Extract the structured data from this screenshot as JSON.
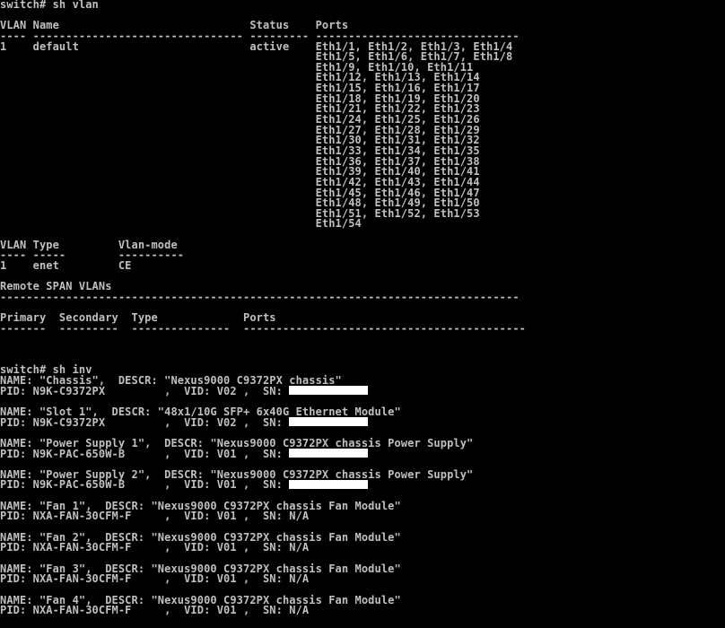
{
  "terminal": {
    "text_color": "#c0c0c0",
    "background": "#000000",
    "lines": [
      "switch# sh vlan",
      "",
      "VLAN Name                             Status    Ports",
      "---- -------------------------------- --------- -------------------------------",
      "1    default                          active    Eth1/1, Eth1/2, Eth1/3, Eth1/4",
      "                                                Eth1/5, Eth1/6, Eth1/7, Eth1/8",
      "                                                Eth1/9, Eth1/10, Eth1/11",
      "                                                Eth1/12, Eth1/13, Eth1/14",
      "                                                Eth1/15, Eth1/16, Eth1/17",
      "                                                Eth1/18, Eth1/19, Eth1/20",
      "                                                Eth1/21, Eth1/22, Eth1/23",
      "                                                Eth1/24, Eth1/25, Eth1/26",
      "                                                Eth1/27, Eth1/28, Eth1/29",
      "                                                Eth1/30, Eth1/31, Eth1/32",
      "                                                Eth1/33, Eth1/34, Eth1/35",
      "                                                Eth1/36, Eth1/37, Eth1/38",
      "                                                Eth1/39, Eth1/40, Eth1/41",
      "                                                Eth1/42, Eth1/43, Eth1/44",
      "                                                Eth1/45, Eth1/46, Eth1/47",
      "                                                Eth1/48, Eth1/49, Eth1/50",
      "                                                Eth1/51, Eth1/52, Eth1/53",
      "                                                Eth1/54",
      "",
      "VLAN Type         Vlan-mode",
      "---- -----        ----------",
      "1    enet         CE",
      "",
      "Remote SPAN VLANs",
      "-------------------------------------------------------------------------------",
      "",
      "Primary  Secondary  Type             Ports",
      "-------  ---------  ---------------  -------------------------------------------",
      "",
      "",
      "",
      "switch# sh inv",
      "NAME: \"Chassis\",  DESCR: \"Nexus9000 C9372PX chassis\"",
      "PID: N9K-C9372PX         ,  VID: V02 ,  SN: ",
      "",
      "NAME: \"Slot 1\",  DESCR: \"48x1/10G SFP+ 6x40G Ethernet Module\"",
      "PID: N9K-C9372PX         ,  VID: V02 ,  SN: ",
      "",
      "NAME: \"Power Supply 1\",  DESCR: \"Nexus9000 C9372PX chassis Power Supply\"",
      "PID: N9K-PAC-650W-B      ,  VID: V01 ,  SN: ",
      "",
      "NAME: \"Power Supply 2\",  DESCR: \"Nexus9000 C9372PX chassis Power Supply\"",
      "PID: N9K-PAC-650W-B      ,  VID: V01 ,  SN: ",
      "",
      "NAME: \"Fan 1\",  DESCR: \"Nexus9000 C9372PX chassis Fan Module\"",
      "PID: NXA-FAN-30CFM-F     ,  VID: V01 ,  SN: N/A",
      "",
      "NAME: \"Fan 2\",  DESCR: \"Nexus9000 C9372PX chassis Fan Module\"",
      "PID: NXA-FAN-30CFM-F     ,  VID: V01 ,  SN: N/A",
      "",
      "NAME: \"Fan 3\",  DESCR: \"Nexus9000 C9372PX chassis Fan Module\"",
      "PID: NXA-FAN-30CFM-F     ,  VID: V01 ,  SN: N/A",
      "",
      "NAME: \"Fan 4\",  DESCR: \"Nexus9000 C9372PX chassis Fan Module\"",
      "PID: NXA-FAN-30CFM-F     ,  VID: V01 ,  SN: N/A"
    ]
  }
}
